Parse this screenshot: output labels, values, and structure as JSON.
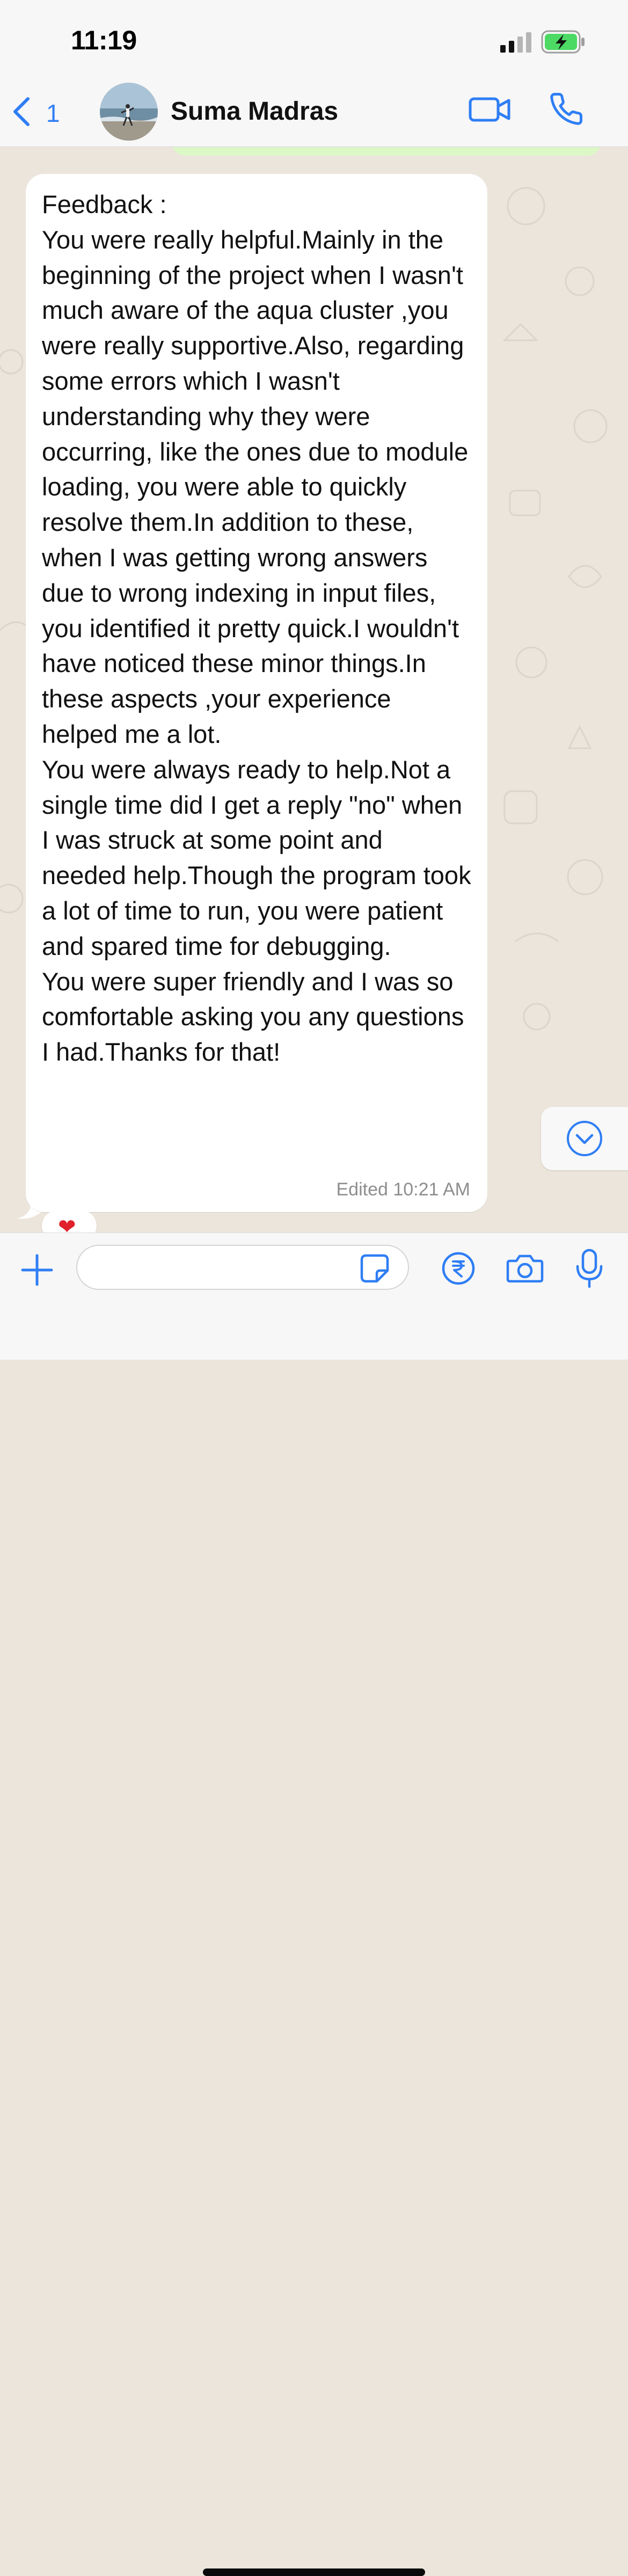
{
  "status_bar": {
    "time": "11:19",
    "icons": [
      "cellular-signal-icon",
      "battery-charging-icon"
    ]
  },
  "header": {
    "back_count": "1",
    "contact_name": "Suma Madras",
    "icons": [
      "back-chevron-icon",
      "avatar-photo",
      "video-call-icon",
      "voice-call-icon"
    ]
  },
  "message": {
    "text": "Feedback :\nYou were really helpful.Mainly in the beginning of the project when I wasn't much aware of the aqua cluster ,you were really supportive.Also, regarding some errors which I wasn't understanding why they were occurring, like the ones due to module loading, you were able to quickly resolve them.In addition to these, when I was getting wrong answers due to wrong indexing in input files, you identified it pretty quick.I wouldn't have noticed these minor things.In these aspects ,your experience helped me a lot.\nYou were always ready to help.Not a single time did I get a reply \"no\" when I was struck at some point and needed help.Though the program took a lot of time to run, you were patient and spared time for debugging.\nYou were super friendly and I was so comfortable asking you any questions I had.Thanks for that!",
    "meta": "Edited 10:21 AM",
    "reaction": "❤"
  },
  "input_bar": {
    "value": "",
    "icons": [
      "plus-icon",
      "sticker-icon",
      "rupee-payment-icon",
      "camera-icon",
      "microphone-icon"
    ]
  },
  "colors": {
    "accent": "#2f7ef5",
    "chat_background": "#ece5dc",
    "incoming_bubble": "#ffffff",
    "outgoing_bubble": "#dbf8c6",
    "battery_fill": "#4cd964",
    "bars": "#f7f7f7"
  }
}
